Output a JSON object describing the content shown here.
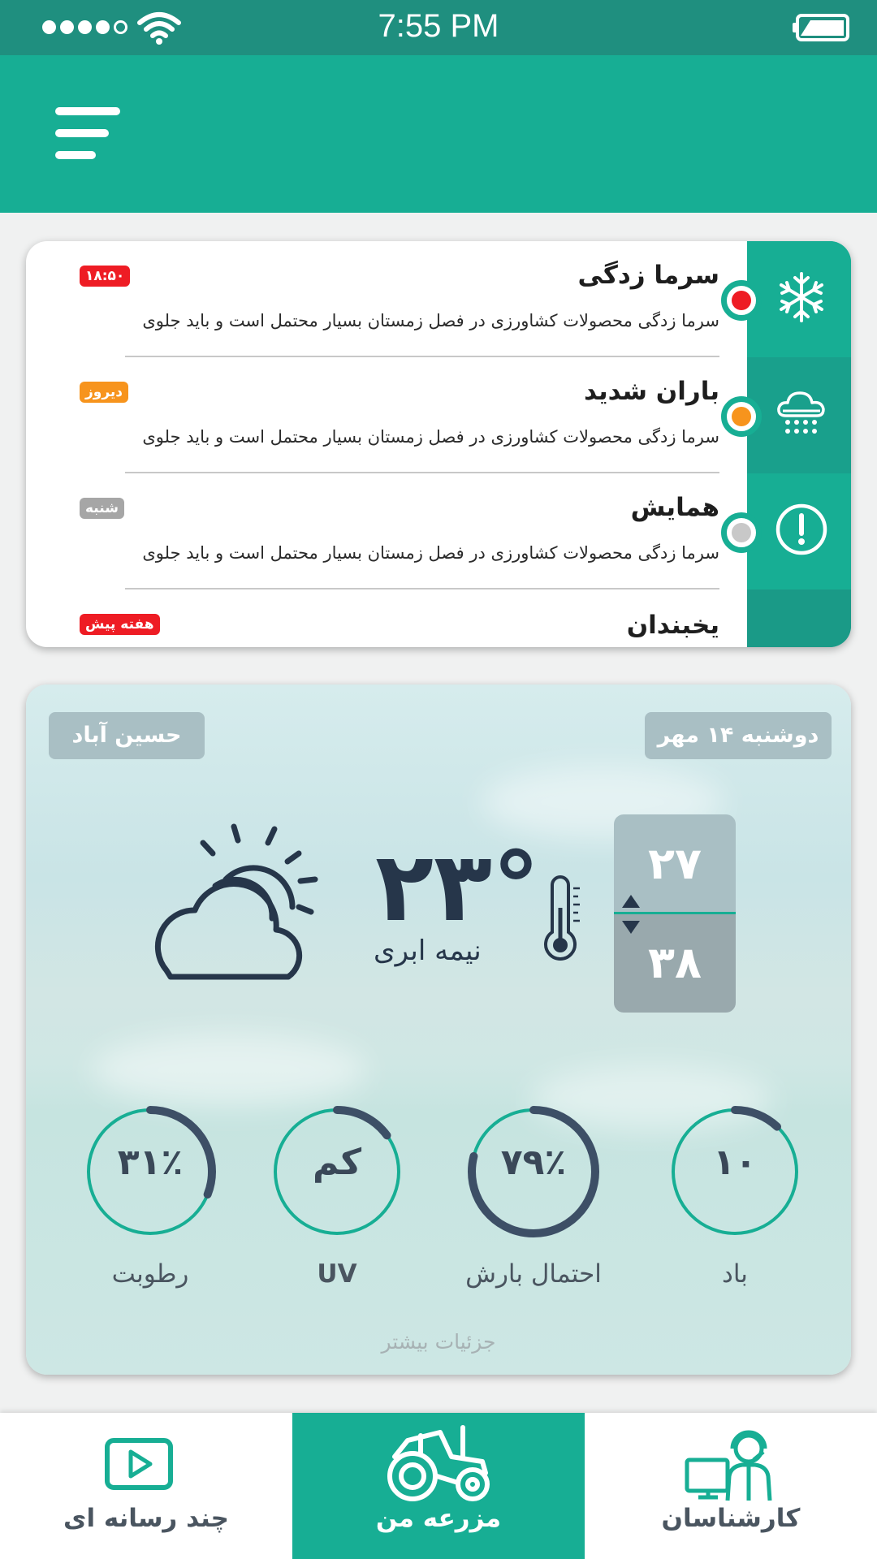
{
  "status_bar": {
    "time": "7:55 PM",
    "signal_icon": "cellular-signal-icon",
    "wifi_icon": "wifi-icon",
    "battery_icon": "battery-icon"
  },
  "header": {
    "menu_icon": "hamburger-menu-icon",
    "bg_color": "#17ae94"
  },
  "alerts": [
    {
      "title": "سرما زدگی",
      "body": "سرما زدگی محصولات کشاورزی در فصل زمستان بسیار محتمل است و باید جلوی",
      "badge": "۱۸:۵۰",
      "badge_color": "#ee1c24",
      "dot_color": "#ee1c24",
      "icon": "snowflake-icon"
    },
    {
      "title": "باران شدید",
      "body": "سرما زدگی محصولات کشاورزی در فصل زمستان بسیار محتمل است و باید جلوی",
      "badge": "دیروز",
      "badge_color": "#f7941d",
      "dot_color": "#f7941d",
      "icon": "heavy-rain-icon"
    },
    {
      "title": "همایش",
      "body": "سرما زدگی محصولات کشاورزی در فصل زمستان بسیار محتمل است و باید جلوی",
      "badge": "شنبه",
      "badge_color": "#a6a6a6",
      "dot_color": "#c8c8c8",
      "icon": "alert-circle-icon"
    },
    {
      "title": "یخبندان",
      "body": "",
      "badge": "هفته پیش",
      "badge_color": "#ee1c24",
      "dot_color": "",
      "icon": ""
    }
  ],
  "weather": {
    "city": "حسین آباد",
    "date": "دوشنبه ۱۴ مهر",
    "temperature": "۲۳°",
    "condition": "نیمه ابری",
    "condition_icon": "partly-cloudy-icon",
    "thermometer_icon": "thermometer-icon",
    "temp_high": "۲۷",
    "temp_low": "۳۸",
    "gauges": [
      {
        "label": "باد",
        "value": "۱۰",
        "fraction": 0.12
      },
      {
        "label": "احتمال بارش",
        "value": "۷۹٪",
        "fraction": 0.79
      },
      {
        "label": "UV",
        "value": "کم",
        "fraction": 0.15
      },
      {
        "label": "رطوبت",
        "value": "۳۱٪",
        "fraction": 0.31
      }
    ],
    "more_link": "جزئیات بیشتر"
  },
  "bottom_nav": {
    "items": [
      {
        "label": "چند رسانه ای",
        "icon": "video-play-icon",
        "active": false
      },
      {
        "label": "مزرعه من",
        "icon": "tractor-icon",
        "active": true
      },
      {
        "label": "کارشناسان",
        "icon": "expert-support-icon",
        "active": false
      }
    ]
  },
  "colors": {
    "primary": "#17ae94",
    "dark": "#26364a",
    "gauge_track": "#17ae94",
    "gauge_fill": "#3d4f66"
  }
}
